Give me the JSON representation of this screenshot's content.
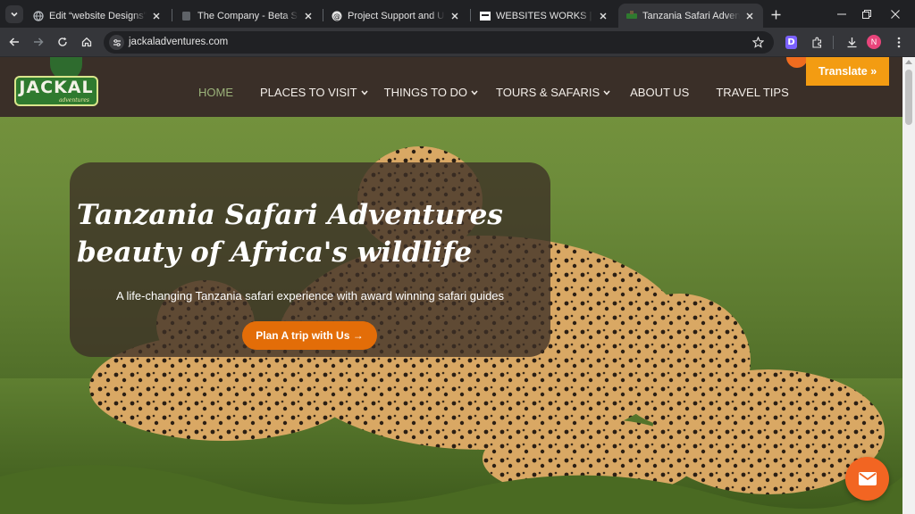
{
  "browser": {
    "tabs": [
      {
        "title": "Edit “website Designs” with E",
        "favicon": "globe-icon",
        "active": false
      },
      {
        "title": "The Company - Beta Smart S",
        "favicon": "document-icon",
        "active": false
      },
      {
        "title": "Project Support and Update",
        "favicon": "threads-icon",
        "active": false
      },
      {
        "title": "WEBSITES WORKS | NORTH",
        "favicon": "site-logo-icon",
        "active": false
      },
      {
        "title": "Tanzania Safari Adventures w",
        "favicon": "jackal-favicon-icon",
        "active": true
      }
    ],
    "url": "jackaladventures.com",
    "extension_badge": "D",
    "profile_initial": "N"
  },
  "site": {
    "logo": {
      "word": "JACKAL",
      "sub": "adventures"
    },
    "nav": [
      {
        "label": "HOME",
        "active": true,
        "dropdown": false
      },
      {
        "label": "PLACES TO VISIT",
        "active": false,
        "dropdown": true
      },
      {
        "label": "THINGS TO DO",
        "active": false,
        "dropdown": true
      },
      {
        "label": "TOURS & SAFARIS",
        "active": false,
        "dropdown": true
      },
      {
        "label": "ABOUT US",
        "active": false,
        "dropdown": false
      },
      {
        "label": "TRAVEL TIPS",
        "active": false,
        "dropdown": false
      }
    ],
    "translate_label": "Translate »"
  },
  "hero": {
    "title_line1": "Tanzania Safari Adventures",
    "title_line2": "beauty of Africa's wildlife",
    "subtitle": "A life-changing Tanzania safari experience with award winning safari guides",
    "cta_label": "Plan A trip with Us →"
  },
  "colors": {
    "header_bg": "#3a2f28",
    "accent_orange": "#e36d08",
    "translate_bg": "#f39c12",
    "nav_active": "#9bb27a"
  },
  "icons": {
    "fab": "email-icon"
  }
}
